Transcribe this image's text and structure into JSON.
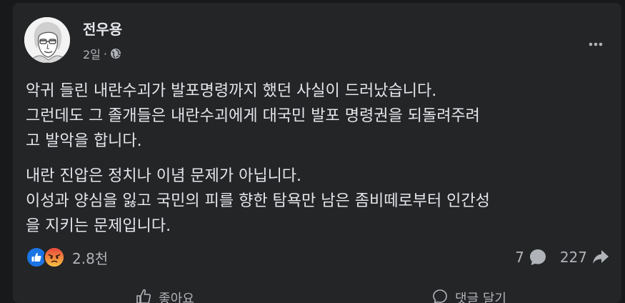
{
  "post": {
    "author": "전우용",
    "time": "2일",
    "separator": "·",
    "privacy_icon": "globe-icon",
    "more_icon": "more-dots-icon",
    "paragraphs": [
      [
        "악귀 들린 내란수괴가 발포명령까지 했던 사실이 드러났습니다.",
        "그런데도 그 졸개들은 내란수괴에게 대국민 발포 명령권을 되돌려주려",
        "고 발악을 합니다."
      ],
      [
        "내란 진압은 정치나 이념 문제가 아닙니다.",
        "이성과 양심을 잃고 국민의 피를 향한 탐욕만 남은 좀비떼로부터 인간성",
        "을 지키는 문제입니다."
      ]
    ]
  },
  "footer": {
    "reaction_icons": [
      "like-icon",
      "angry-icon"
    ],
    "reaction_count": "2.8천",
    "comment_count": "7",
    "share_count": "227",
    "comment_icon": "comment-icon",
    "share_icon": "share-icon"
  },
  "actions": {
    "like_label": "좋아요",
    "comment_label": "댓글 달기"
  },
  "colors": {
    "page_bg": "#18191a",
    "card_bg": "#242526",
    "text_primary": "#e4e6eb",
    "text_secondary": "#b0b3b8",
    "like_blue": "#1b74e4",
    "angry_orange": "#ef7b3e"
  }
}
